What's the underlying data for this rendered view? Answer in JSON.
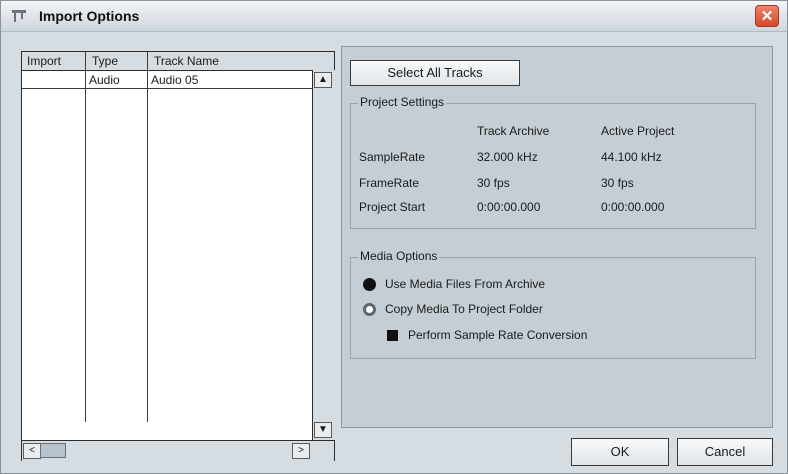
{
  "window": {
    "title": "Import Options",
    "close_glyph": "✕"
  },
  "track_list": {
    "columns": [
      "Import",
      "Type",
      "Track Name"
    ],
    "rows": [
      {
        "import": "",
        "type": "Audio",
        "track_name": "Audio 05"
      }
    ]
  },
  "scroll": {
    "up": "▲",
    "down": "▼",
    "left": "<",
    "right": ">"
  },
  "buttons": {
    "select_all": "Select All Tracks",
    "ok": "OK",
    "cancel": "Cancel"
  },
  "project_settings": {
    "title": "Project Settings",
    "col_archive": "Track Archive",
    "col_active": "Active Project",
    "rows": [
      {
        "label": "SampleRate",
        "archive": "32.000 kHz",
        "active": "44.100 kHz"
      },
      {
        "label": "FrameRate",
        "archive": "30 fps",
        "active": "30 fps"
      },
      {
        "label": "Project Start",
        "archive": "0:00:00.000",
        "active": "0:00:00.000"
      }
    ]
  },
  "media_options": {
    "title": "Media Options",
    "use_archive": "Use Media Files From Archive",
    "use_archive_selected": true,
    "copy_media": "Copy Media To Project Folder",
    "copy_media_selected": false,
    "src_conversion": "Perform Sample Rate Conversion",
    "src_conversion_checked": true
  }
}
